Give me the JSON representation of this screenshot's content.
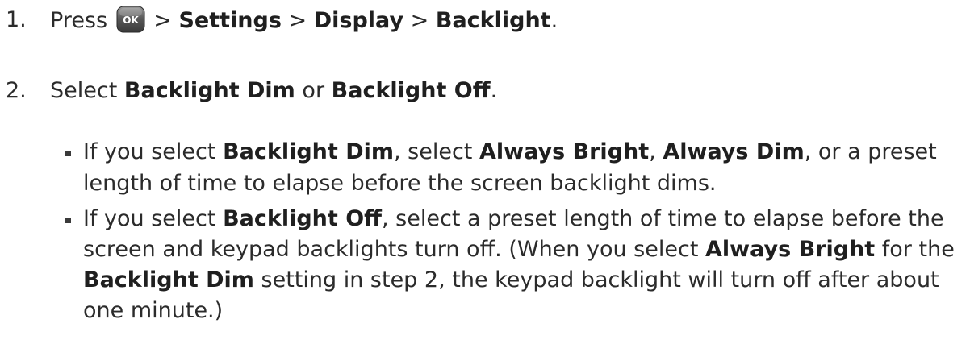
{
  "step1": {
    "number": "1.",
    "press": "Press",
    "ok_key_label": "OK",
    "sep1": ">",
    "settings": "Settings",
    "sep2": ">",
    "display": "Display",
    "sep3": ">",
    "backlight": "Backlight",
    "end": "."
  },
  "step2": {
    "number": "2.",
    "select": "Select",
    "backlight_dim": "Backlight Dim",
    "or": "or",
    "backlight_off": "Backlight Off",
    "end": "."
  },
  "bullet1": {
    "if_you_select": "If you select",
    "backlight_dim": "Backlight Dim",
    "select": ", select",
    "always_bright": "Always Bright",
    "comma": ",",
    "always_dim": "Always Dim",
    "tail": ", or a preset",
    "line2": "length of time to elapse before the screen backlight dims."
  },
  "bullet2": {
    "if_you_select": "If you select",
    "backlight_off": "Backlight Off",
    "line1_tail": ", select a preset length of time to elapse before the",
    "line2_head": "screen and keypad backlights turn off. (When you select",
    "always_bright": "Always Bright",
    "for_the": "for the",
    "backlight_dim": "Backlight Dim",
    "line3_tail": "setting in step 2, the keypad backlight will turn off after about",
    "line4": "one minute.)"
  },
  "icons": {
    "ok_key": "ok-key-icon"
  }
}
